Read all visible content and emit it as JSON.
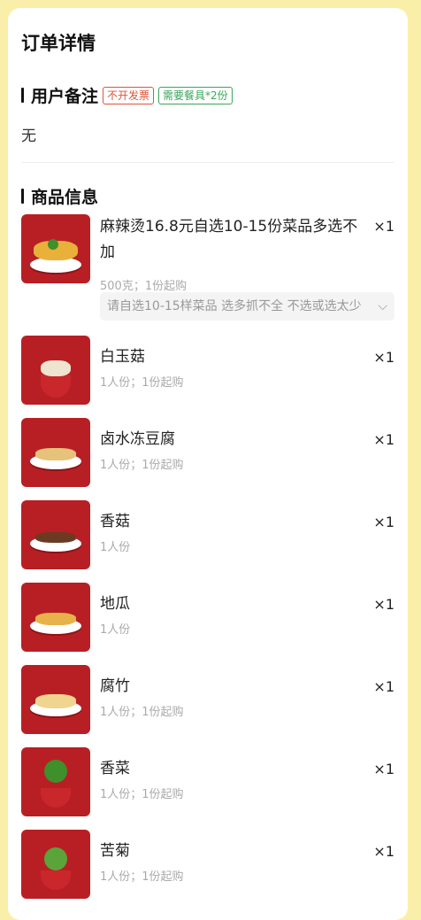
{
  "page": {
    "title": "订单详情"
  },
  "remark_section": {
    "title": "用户备注",
    "tags": [
      "不开发票",
      "需要餐具*2份"
    ],
    "text": "无"
  },
  "goods_section": {
    "title": "商品信息",
    "items": [
      {
        "name": "麻辣烫16.8元自选10-15份菜品多选不加",
        "sub": "500克；1份起购",
        "qty": "×1",
        "selector": "请自选10-15样菜品 选多抓不全 不选或选太少"
      },
      {
        "name": "白玉菇",
        "sub": "1人份；1份起购",
        "qty": "×1"
      },
      {
        "name": "卤水冻豆腐",
        "sub": "1人份；1份起购",
        "qty": "×1"
      },
      {
        "name": "香菇",
        "sub": "1人份",
        "qty": "×1"
      },
      {
        "name": "地瓜",
        "sub": "1人份",
        "qty": "×1"
      },
      {
        "name": "腐竹",
        "sub": "1人份；1份起购",
        "qty": "×1"
      },
      {
        "name": "香菜",
        "sub": "1人份；1份起购",
        "qty": "×1"
      },
      {
        "name": "苦菊",
        "sub": "1人份；1份起购",
        "qty": "×1"
      }
    ]
  },
  "colors": {
    "background": "#faefa8",
    "tag_red": "#e0533a",
    "tag_green": "#39a65a",
    "thumb_red": "#b81f24"
  }
}
